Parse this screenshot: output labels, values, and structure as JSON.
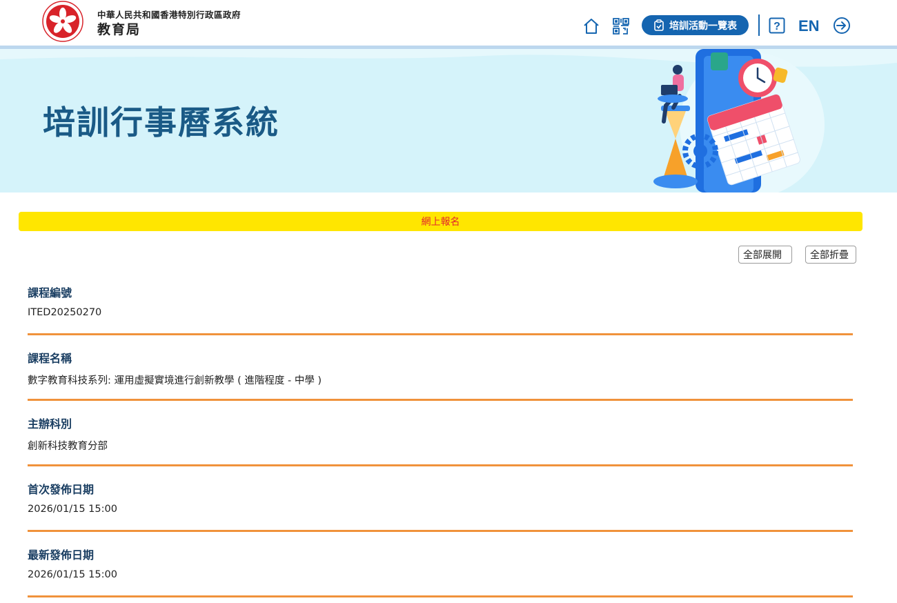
{
  "header": {
    "org_name": "中華人民共和國香港特別行政區政府",
    "bureau": "教育局",
    "logo_icon": "hksar-bauhinia-emblem",
    "home_icon": "home-icon",
    "qr_icon": "qr-code-icon",
    "activities_button": "培訓活動一覽表",
    "help_label": "?",
    "language": "EN",
    "logout_icon": "logout-icon"
  },
  "banner": {
    "title": "培訓行事曆系統"
  },
  "notice": {
    "label": "網上報名"
  },
  "controls": {
    "expand_all": "全部展開",
    "collapse_all": "全部折疊"
  },
  "fields": [
    {
      "label": "課程編號",
      "value": "ITED20250270"
    },
    {
      "label": "課程名稱",
      "value": "數字教育科技系列: 運用虛擬實境進行創新教學 ( 進階程度 - 中學 )"
    },
    {
      "label": "主辦科別",
      "value": "創新科技教育分部"
    },
    {
      "label": "首次發佈日期",
      "value": "2026/01/15 15:00"
    },
    {
      "label": "最新發佈日期",
      "value": "2026/01/15 15:00"
    }
  ],
  "colors": {
    "primary": "#1565b0",
    "banner_bg": "#d5f3fa",
    "notice_bg": "#ffe600",
    "notice_text": "#e3262d",
    "divider": "#f0923b",
    "label": "#1a3e62"
  }
}
